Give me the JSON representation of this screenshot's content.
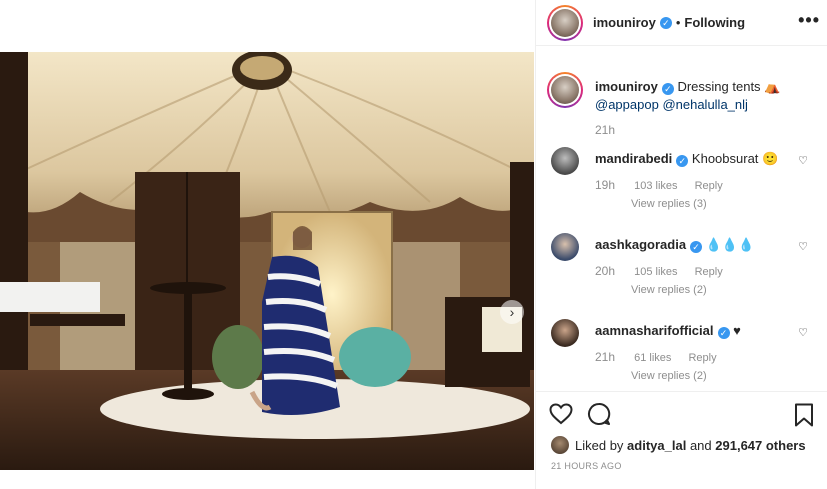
{
  "post": {
    "author": "imouniroy",
    "follow_sep": "•",
    "follow_label": "Following",
    "more_label": "•••"
  },
  "caption": {
    "username": "imouniroy",
    "text": "Dressing tents",
    "mention1": "@appapop",
    "mention2": "@nehalulla_nlj",
    "time": "21h"
  },
  "comments": [
    {
      "username": "mandirabedi",
      "text": "Khoobsurat 🙂",
      "time": "19h",
      "likes": "103 likes",
      "reply": "Reply",
      "view_replies": "View replies (3)",
      "heart": "♡"
    },
    {
      "username": "aashkagoradia",
      "text": "💧💧💧",
      "time": "20h",
      "likes": "105 likes",
      "reply": "Reply",
      "view_replies": "View replies (2)",
      "heart": "♡"
    },
    {
      "username": "aamnasharifofficial",
      "text": "♥",
      "time": "21h",
      "likes": "61 likes",
      "reply": "Reply",
      "view_replies": "View replies (2)",
      "heart": "♡"
    }
  ],
  "likes": {
    "prefix": "Liked by",
    "user": "aditya_lal",
    "and": "and",
    "others": "291,647 others"
  },
  "posted_ago": "21 HOURS AGO",
  "carousel_next": "›",
  "colors": {
    "verified": "#3897f0",
    "mention": "#003569",
    "muted": "#8e8e8e"
  }
}
